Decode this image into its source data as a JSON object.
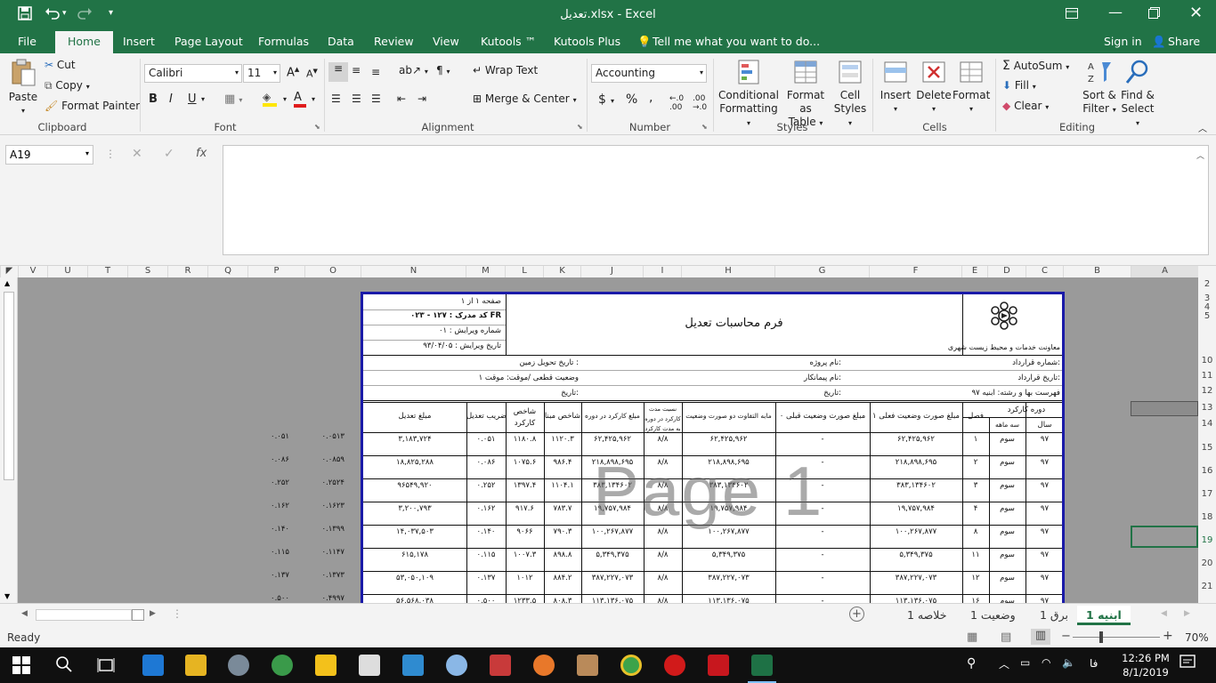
{
  "window": {
    "title": "تعدیل.xlsx - Excel",
    "accent": "#217346"
  },
  "qat": {
    "save_icon": "save-icon",
    "undo_icon": "undo-icon",
    "redo_icon": "redo-icon"
  },
  "tabs": [
    "File",
    "Home",
    "Insert",
    "Page Layout",
    "Formulas",
    "Data",
    "Review",
    "View",
    "Kutools ™",
    "Kutools Plus"
  ],
  "tell_me": "Tell me what you want to do...",
  "sign_in": "Sign in",
  "share": "Share",
  "ribbon": {
    "clipboard": {
      "paste": "Paste",
      "cut": "Cut",
      "copy": "Copy",
      "format_painter": "Format Painter",
      "label": "Clipboard"
    },
    "font": {
      "name": "Calibri",
      "size": "11",
      "label": "Font",
      "bold": "B",
      "italic": "I",
      "underline": "U"
    },
    "alignment": {
      "wrap_text": "Wrap Text",
      "merge_center": "Merge & Center",
      "label": "Alignment"
    },
    "number": {
      "format": "Accounting",
      "label": "Number",
      "currency": "$",
      "percent": "%",
      "comma": ","
    },
    "styles": {
      "conditional": "Conditional",
      "conditional2": "Formatting",
      "format_as": "Format as",
      "format_as2": "Table",
      "cell": "Cell",
      "cell2": "Styles",
      "label": "Styles"
    },
    "cells": {
      "insert": "Insert",
      "delete": "Delete",
      "format": "Format",
      "label": "Cells"
    },
    "editing": {
      "autosum": "AutoSum",
      "fill": "Fill",
      "clear": "Clear",
      "sort": "Sort &",
      "sort2": "Filter",
      "find": "Find &",
      "find2": "Select",
      "label": "Editing"
    }
  },
  "formula_bar": {
    "name_box": "A19",
    "fx": "fx",
    "value": ""
  },
  "columns": [
    "V",
    "U",
    "T",
    "S",
    "R",
    "Q",
    "P",
    "O",
    "N",
    "M",
    "L",
    "K",
    "J",
    "I",
    "H",
    "G",
    "F",
    "E",
    "D",
    "C",
    "B",
    "A"
  ],
  "rows": [
    "2",
    "3",
    "4",
    "5",
    "10",
    "11",
    "12",
    "13",
    "14",
    "15",
    "16",
    "17",
    "18",
    "19",
    "20",
    "21"
  ],
  "page": {
    "title": "فرم محاسبات تعدیل",
    "org": "معاونت خدمات و محیط زیست شهری",
    "page_no": "صفحه ۱ از ۱",
    "doc_code": "کد مدرک : ۱۲۷ - ۰۲۳ FR",
    "edition": "شماره ویرایش : ۰۱",
    "edition_date": "تاریخ ویرایش : ۹۳/۰۴/۰۵",
    "contract_no": "شماره قرارداد:",
    "project": "نام پروژه:",
    "land_date": "تاریخ تحویل زمین :",
    "contract_date": "تاریخ قرارداد:",
    "contractor": "نام پیمانکار:",
    "status_line": "وضعیت قطعی /موقت: موقت ۱",
    "price_list": "فهرست بها و رشته: ابنیه ۹۷",
    "date1": "تاریخ:",
    "date2": "تاریخ:",
    "headers": {
      "period": "دوره کارکرد",
      "year": "سال",
      "quarter": "سه ماهه",
      "season": "فصل",
      "amount_current": "مبلغ صورت وضعیت فعلی ۱",
      "amount_prev": "مبلغ صورت وضعیت قبلی ۰",
      "diff": "مابه التفاوت دو صورت وضعیت",
      "ratio": "نسبت مدت کارکرد در دوره به مدت کارکرد",
      "work_amount": "مبلغ کارکرد در دوره",
      "base_index": "شاخص مبنا",
      "work_index": "شاخص کارکرد",
      "coef": "ضریب تعدیل",
      "adj_amount": "مبلغ تعدیل"
    },
    "data_rows": [
      {
        "year": "۹۷",
        "q": "سوم",
        "season": "۱",
        "cur": "۶۲,۴۲۵,۹۶۲",
        "prev": "-",
        "diff": "۶۲,۴۲۵,۹۶۲",
        "ratio": "۸/۸",
        "work": "۶۲,۴۲۵,۹۶۲",
        "base": "۱۱۲۰.۳",
        "idx": "۱۱۸۰.۸",
        "coef": "۰.۰۵۱",
        "adj": "۳,۱۸۳,۷۲۴",
        "o": "۰.۰۵۱۳",
        "p": "۰.۰۵۱"
      },
      {
        "year": "۹۷",
        "q": "سوم",
        "season": "۲",
        "cur": "۲۱۸,۸۹۸,۶۹۵",
        "prev": "-",
        "diff": "۲۱۸,۸۹۸,۶۹۵",
        "ratio": "۸/۸",
        "work": "۲۱۸,۸۹۸,۶۹۵",
        "base": "۹۸۶.۴",
        "idx": "۱۰۷۵.۶",
        "coef": "۰.۰۸۶",
        "adj": "۱۸,۸۲۵,۲۸۸",
        "o": "۰.۰۸۵۹",
        "p": "۰.۰۸۶"
      },
      {
        "year": "۹۷",
        "q": "سوم",
        "season": "۳",
        "cur": "۳۸۳,۱۳۴۶۰۲",
        "prev": "-",
        "diff": "۳۸۳,۱۳۴۶۰۲",
        "ratio": "۸/۸",
        "work": "۳۸۳,۱۳۴۶۰۲",
        "base": "۱۱۰۴.۱",
        "idx": "۱۳۹۷.۴",
        "coef": "۰.۲۵۲",
        "adj": "۹۶۵۴۹,۹۲۰",
        "o": "۰.۲۵۲۴",
        "p": "۰.۲۵۲"
      },
      {
        "year": "۹۷",
        "q": "سوم",
        "season": "۴",
        "cur": "۱۹,۷۵۷,۹۸۴",
        "prev": "-",
        "diff": "۱۹,۷۵۷,۹۸۴",
        "ratio": "۸/۸",
        "work": "۱۹,۷۵۷,۹۸۴",
        "base": "۷۸۳.۷",
        "idx": "۹۱۷.۶",
        "coef": "۰.۱۶۲",
        "adj": "۳,۲۰۰,۷۹۳",
        "o": "۰.۱۶۲۳",
        "p": "۰.۱۶۲"
      },
      {
        "year": "۹۷",
        "q": "سوم",
        "season": "۸",
        "cur": "۱۰۰,۲۶۷,۸۷۷",
        "prev": "-",
        "diff": "۱۰۰,۲۶۷,۸۷۷",
        "ratio": "۸/۸",
        "work": "۱۰۰,۲۶۷,۸۷۷",
        "base": "۷۹۰.۳",
        "idx": "۹۰۶۶",
        "coef": "۰.۱۴۰",
        "adj": "۱۴,۰۳۷,۵۰۳",
        "o": "۰.۱۳۹۹",
        "p": "۰.۱۴۰"
      },
      {
        "year": "۹۷",
        "q": "سوم",
        "season": "۱۱",
        "cur": "۵,۳۴۹,۳۷۵",
        "prev": "-",
        "diff": "۵,۳۴۹,۳۷۵",
        "ratio": "۸/۸",
        "work": "۵,۳۴۹,۳۷۵",
        "base": "۸۹۸.۸",
        "idx": "۱۰۰۷.۳",
        "coef": "۰.۱۱۵",
        "adj": "۶۱۵,۱۷۸",
        "o": "۰.۱۱۴۷",
        "p": "۰.۱۱۵"
      },
      {
        "year": "۹۷",
        "q": "سوم",
        "season": "۱۲",
        "cur": "۳۸۷,۲۲۷,۰۷۳",
        "prev": "-",
        "diff": "۳۸۷,۲۲۷,۰۷۳",
        "ratio": "۸/۸",
        "work": "۳۸۷,۲۲۷,۰۷۳",
        "base": "۸۸۴.۲",
        "idx": "۱۰۱۲",
        "coef": "۰.۱۳۷",
        "adj": "۵۳,۰۵۰,۱۰۹",
        "o": "۰.۱۳۷۳",
        "p": "۰.۱۳۷"
      },
      {
        "year": "۹۷",
        "q": "سوم",
        "season": "۱۶",
        "cur": "۱۱۳,۱۳۶,۰۷۵",
        "prev": "-",
        "diff": "۱۱۳,۱۳۶,۰۷۵",
        "ratio": "۸/۸",
        "work": "۱۱۳,۱۳۶,۰۷۵",
        "base": "۸۰۸.۳",
        "idx": "۱۲۳۳.۵",
        "coef": "۰.۵۰۰",
        "adj": "۵۶,۵۶۸,۰۳۸",
        "o": "۰.۴۹۹۷",
        "p": "۰.۵۰۰"
      }
    ],
    "watermark": "Page 1"
  },
  "sheets": [
    "1 ابنیه",
    "برق 1",
    "وضعیت 1",
    "خلاصه 1"
  ],
  "status": {
    "ready": "Ready",
    "zoom": "70%"
  },
  "taskbar": {
    "time": "12:26 PM",
    "date": "8/1/2019",
    "lang": "فا"
  }
}
